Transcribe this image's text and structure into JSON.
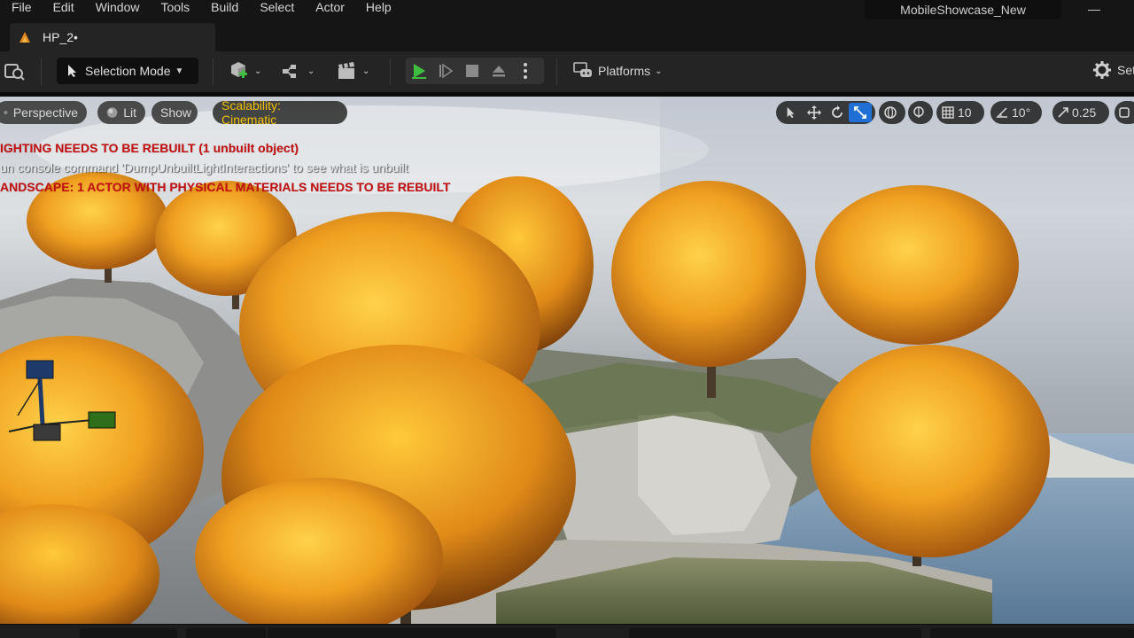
{
  "menu": [
    "File",
    "Edit",
    "Window",
    "Tools",
    "Build",
    "Select",
    "Actor",
    "Help"
  ],
  "project_name": "MobileShowcase_New",
  "window_minimize": "—",
  "tab": {
    "label": "HP_2•"
  },
  "toolbar": {
    "selection_mode": "Selection Mode",
    "platforms": "Platforms",
    "settings": "Set"
  },
  "viewport": {
    "perspective": "Perspective",
    "lit": "Lit",
    "show": "Show",
    "scalability": "Scalability: Cinematic",
    "grid_snap": "10",
    "rotation_snap": "10°",
    "scale_snap": "0.25"
  },
  "messages": {
    "lighting": "IGHTING NEEDS TO BE REBUILT (1 unbuilt object)",
    "console": "un console command 'DumpUnbuiltLightInteractions' to see what is unbuilt",
    "landscape": "ANDSCAPE: 1 ACTOR WITH PHYSICAL MATERIALS NEEDS TO BE REBUILT"
  },
  "colors": {
    "accent_blue": "#1f6fd6",
    "play_green": "#3fbf3f",
    "warning_red": "#c41010",
    "scalability_yellow": "#f2c200"
  }
}
